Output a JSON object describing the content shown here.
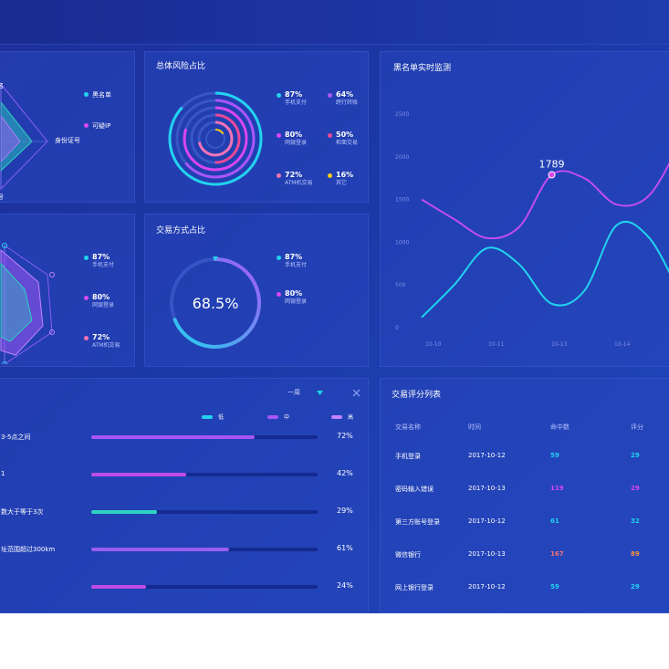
{
  "panels": {
    "risk_share": {
      "title": "总体风险占比"
    },
    "blacklist_monitor": {
      "title": "黑名单实时监测"
    },
    "trade_method": {
      "title": "交易方式占比",
      "center_value": "68.5%"
    },
    "trade_score": {
      "title": "交易评分列表"
    }
  },
  "radar_top": {
    "partial_label_top": "名",
    "axis_label_right": "身份证号",
    "partial_label_bottom": "号",
    "legend": [
      {
        "label": "黑名单",
        "color": "#22d3ee"
      },
      {
        "label": "可疑IP",
        "color": "#d946ef"
      }
    ]
  },
  "risk_legend": [
    {
      "pct": "87%",
      "label": "手机支付",
      "color": "#22d3ee"
    },
    {
      "pct": "64%",
      "label": "跨行转账",
      "color": "#a855f7"
    },
    {
      "pct": "80%",
      "label": "网银登录",
      "color": "#d946ef"
    },
    {
      "pct": "50%",
      "label": "柜面交易",
      "color": "#ec4899"
    },
    {
      "pct": "72%",
      "label": "ATM机交易",
      "color": "#f472b6"
    },
    {
      "pct": "16%",
      "label": "其它",
      "color": "#facc15"
    }
  ],
  "radar_mid_legend": [
    {
      "pct": "87%",
      "label": "手机支付",
      "color": "#22d3ee"
    },
    {
      "pct": "80%",
      "label": "网银登录",
      "color": "#d946ef"
    },
    {
      "pct": "72%",
      "label": "ATM机交易",
      "color": "#f472b6"
    }
  ],
  "trade_legend": [
    {
      "pct": "87%",
      "label": "手机支付",
      "color": "#22d3ee"
    },
    {
      "pct": "80%",
      "label": "网银登录",
      "color": "#d946ef"
    }
  ],
  "bars_panel": {
    "period": "一周",
    "legend": [
      {
        "label": "低",
        "color": "#22d3ee"
      },
      {
        "label": "中",
        "color": "#a855f7"
      },
      {
        "label": "高",
        "color": "#c084fc"
      }
    ],
    "rows": [
      {
        "label": "3-5点之间",
        "value": 72,
        "text": "72%",
        "color": "#a855f7"
      },
      {
        "label": "1",
        "value": 42,
        "text": "42%",
        "color": "#c04be6"
      },
      {
        "label": "数大于等于3次",
        "value": 29,
        "text": "29%",
        "color": "#2dd4bf"
      },
      {
        "label": "址范围超过300km",
        "value": 61,
        "text": "61%",
        "color": "#9b5cf0"
      },
      {
        "label": "",
        "value": 24,
        "text": "24%",
        "color": "#c04be6"
      }
    ]
  },
  "score_table": {
    "headers": [
      "交易名称",
      "时间",
      "命中数",
      "评分"
    ],
    "rows": [
      {
        "name": "手机登录",
        "time": "2017-10-12",
        "hits": "59",
        "score": "29",
        "hits_color": "#22d3ee",
        "score_color": "#22d3ee"
      },
      {
        "name": "密码输入错误",
        "time": "2017-10-13",
        "hits": "119",
        "score": "29",
        "hits_color": "#d946ef",
        "score_color": "#d946ef"
      },
      {
        "name": "第三方账号登录",
        "time": "2017-10-12",
        "hits": "61",
        "score": "32",
        "hits_color": "#22d3ee",
        "score_color": "#22d3ee"
      },
      {
        "name": "微信银行",
        "time": "2017-10-13",
        "hits": "167",
        "score": "89",
        "hits_color": "#f87171",
        "score_color": "#fb923c"
      },
      {
        "name": "网上银行登录",
        "time": "2017-10-12",
        "hits": "59",
        "score": "29",
        "hits_color": "#22d3ee",
        "score_color": "#22d3ee"
      }
    ]
  },
  "chart_data": {
    "type": "line",
    "x": [
      "10-10",
      "10-11",
      "10-13",
      "10-14"
    ],
    "yticks": [
      "0",
      "500",
      "1000",
      "1500",
      "2000",
      "2500"
    ],
    "ylim": [
      0,
      2500
    ],
    "annotation": {
      "text": "1789"
    },
    "series": [
      {
        "color": "#c24cf0",
        "points": [
          [
            0,
            1500
          ],
          [
            0.5,
            1270
          ],
          [
            1,
            1050
          ],
          [
            1.5,
            1180
          ],
          [
            2,
            1789
          ],
          [
            2.5,
            1750
          ],
          [
            3,
            1440
          ],
          [
            3.5,
            1550
          ],
          [
            4,
            2200
          ]
        ]
      },
      {
        "color": "#22d3ee",
        "points": [
          [
            0,
            120
          ],
          [
            0.5,
            500
          ],
          [
            1,
            930
          ],
          [
            1.5,
            740
          ],
          [
            2,
            280
          ],
          [
            2.5,
            430
          ],
          [
            3,
            1200
          ],
          [
            3.5,
            1050
          ],
          [
            4,
            350
          ]
        ]
      }
    ]
  }
}
